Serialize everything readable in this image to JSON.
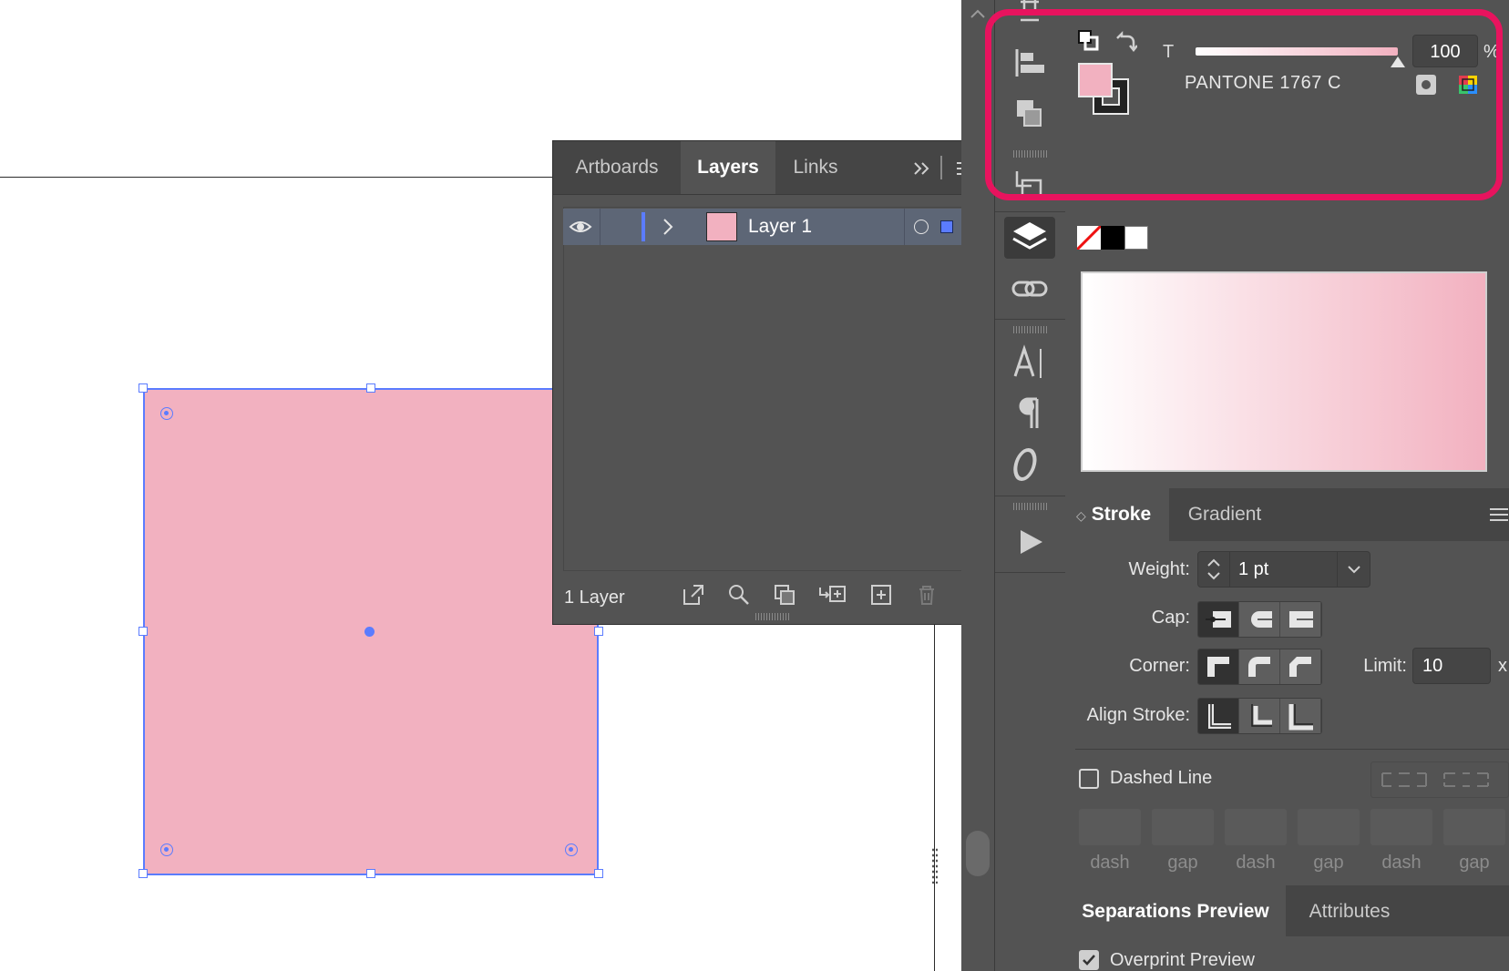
{
  "layers_panel": {
    "tabs": [
      "Artboards",
      "Layers",
      "Links"
    ],
    "active_tab": "Layers",
    "layer_name": "Layer 1",
    "footer_count": "1 Layer"
  },
  "color_panel": {
    "tint_label": "T",
    "tint_value": "100",
    "tint_unit": "%",
    "swatch_name": "PANTONE 1767 C",
    "fill_color": "#f2b1c0",
    "tint_fraction": 1.0
  },
  "stroke_panel": {
    "tabs": [
      "Stroke",
      "Gradient"
    ],
    "weight_label": "Weight:",
    "weight_value": "1 pt",
    "cap_label": "Cap:",
    "corner_label": "Corner:",
    "limit_label": "Limit:",
    "limit_value": "10",
    "limit_unit": "x",
    "align_label": "Align Stroke:",
    "dashed_label": "Dashed Line",
    "dash_labels": [
      "dash",
      "gap",
      "dash",
      "gap",
      "dash",
      "gap"
    ]
  },
  "bottom_panel": {
    "tabs": [
      "Separations Preview",
      "Attributes"
    ],
    "overprint_label": "Overprint Preview"
  },
  "colors": {
    "selection": "#5b7cff",
    "highlight": "#e8135e",
    "panel_bg": "#535353"
  }
}
